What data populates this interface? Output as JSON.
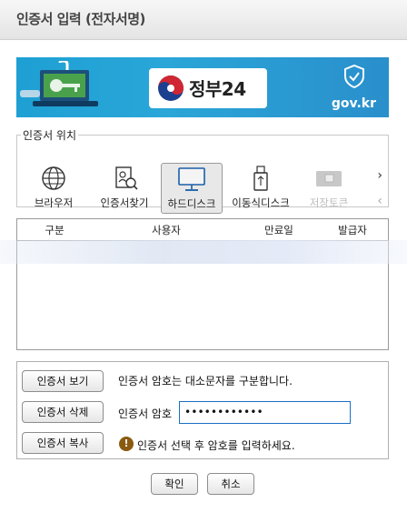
{
  "window": {
    "title": "인증서 입력 (전자서명)"
  },
  "banner": {
    "brand": "정부24",
    "domain": "gov.kr"
  },
  "location": {
    "legend": "인증서 위치",
    "options": [
      {
        "label": "브라우저"
      },
      {
        "label": "인증서찾기"
      },
      {
        "label": "하드디스크"
      },
      {
        "label": "이동식디스크"
      },
      {
        "label": "저장토큰"
      }
    ],
    "selected": "하드디스크",
    "disabled": "저장토큰"
  },
  "cert_table": {
    "columns": [
      "구분",
      "사용자",
      "만료일",
      "발급자"
    ]
  },
  "actions": {
    "view": "인증서 보기",
    "delete": "인증서 삭제",
    "copy": "인증서 복사"
  },
  "password": {
    "hint": "인증서 암호는 대소문자를 구분합니다.",
    "label": "인증서 암호",
    "value": "••••••••••••",
    "warning": "인증서 선택 후 암호를 입력하세요."
  },
  "footer": {
    "ok": "확인",
    "cancel": "취소"
  },
  "colors": {
    "banner": "#1ea0d4",
    "input_border": "#1a6fc4",
    "warning_icon": "#8a5a12"
  }
}
